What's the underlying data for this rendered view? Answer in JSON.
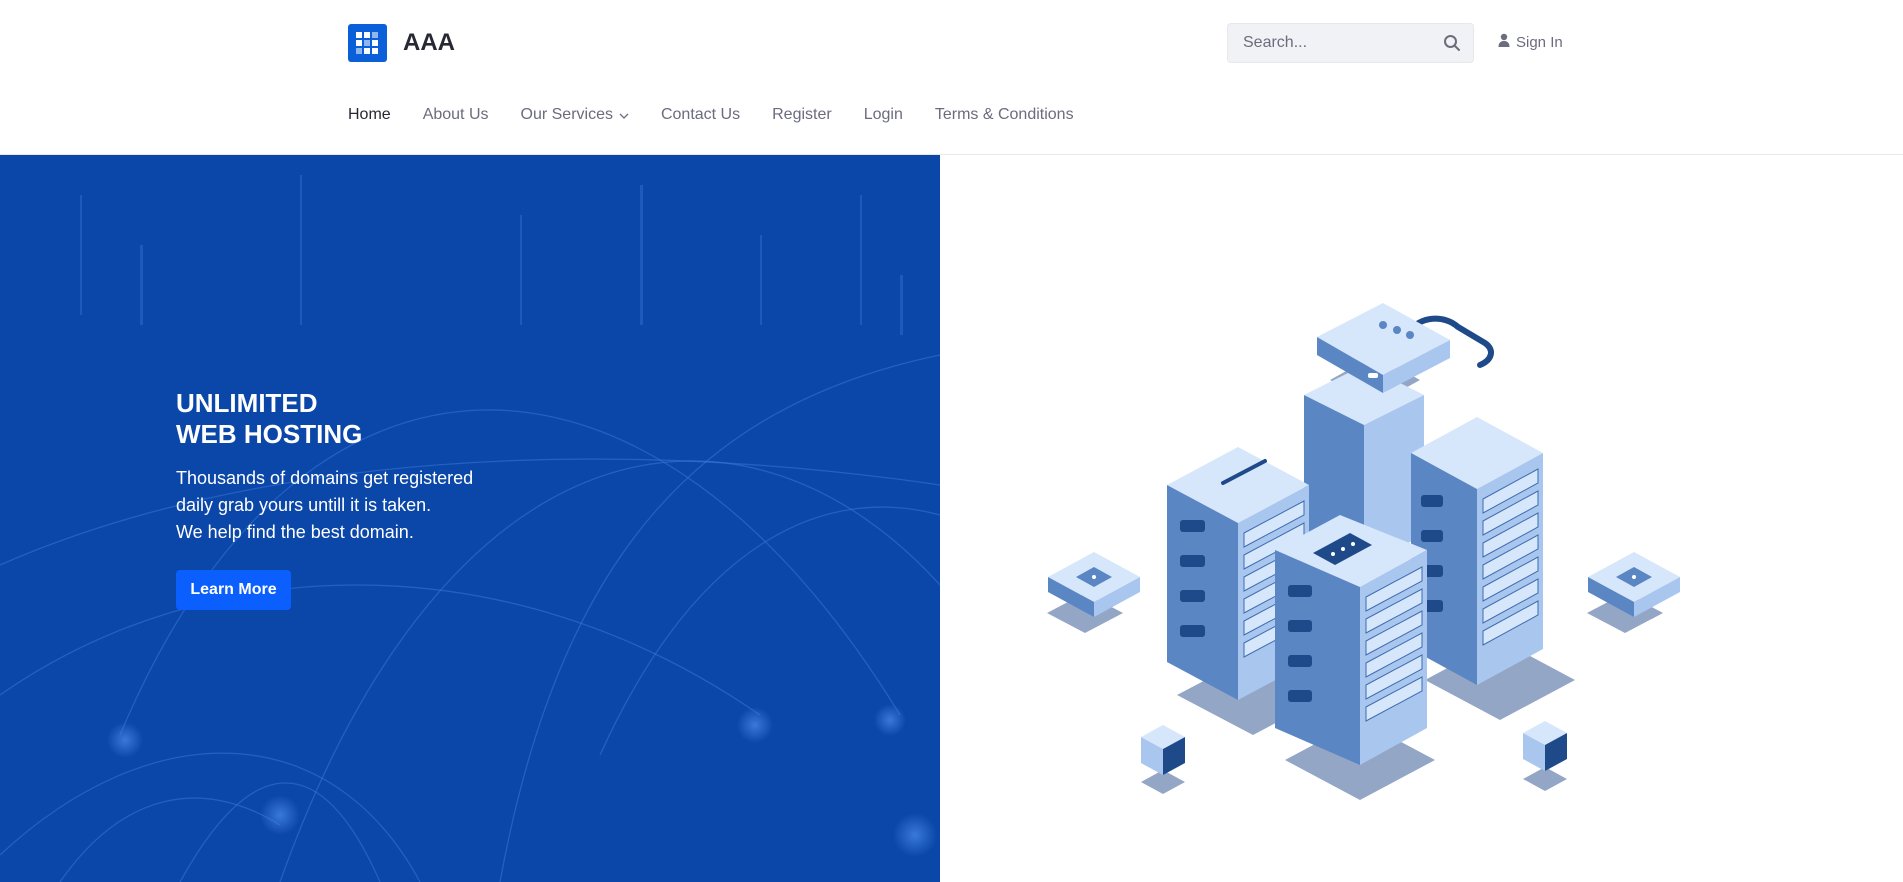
{
  "brand": {
    "name": "AAA",
    "logo_icon": "grid-logo-icon",
    "color": "#0b5fd8"
  },
  "search": {
    "placeholder": "Search...",
    "icon": "search-icon"
  },
  "signin": {
    "label": "Sign In",
    "icon": "user-icon"
  },
  "nav": {
    "items": [
      {
        "label": "Home",
        "active": true
      },
      {
        "label": "About Us"
      },
      {
        "label": "Our Services",
        "has_dropdown": true
      },
      {
        "label": "Contact Us"
      },
      {
        "label": "Register"
      },
      {
        "label": "Login"
      },
      {
        "label": "Terms & Conditions"
      }
    ]
  },
  "hero": {
    "title_line1": "UNLIMITED",
    "title_line2": "WEB HOSTING",
    "text_line1": "Thousands of domains get registered",
    "text_line2": "daily grab yours untill it is taken.",
    "text_line3": "We help find the best domain.",
    "button_label": "Learn More",
    "background_color": "#0b47a8",
    "button_color": "#0b5fff",
    "illustration": "server-racks-illustration"
  }
}
